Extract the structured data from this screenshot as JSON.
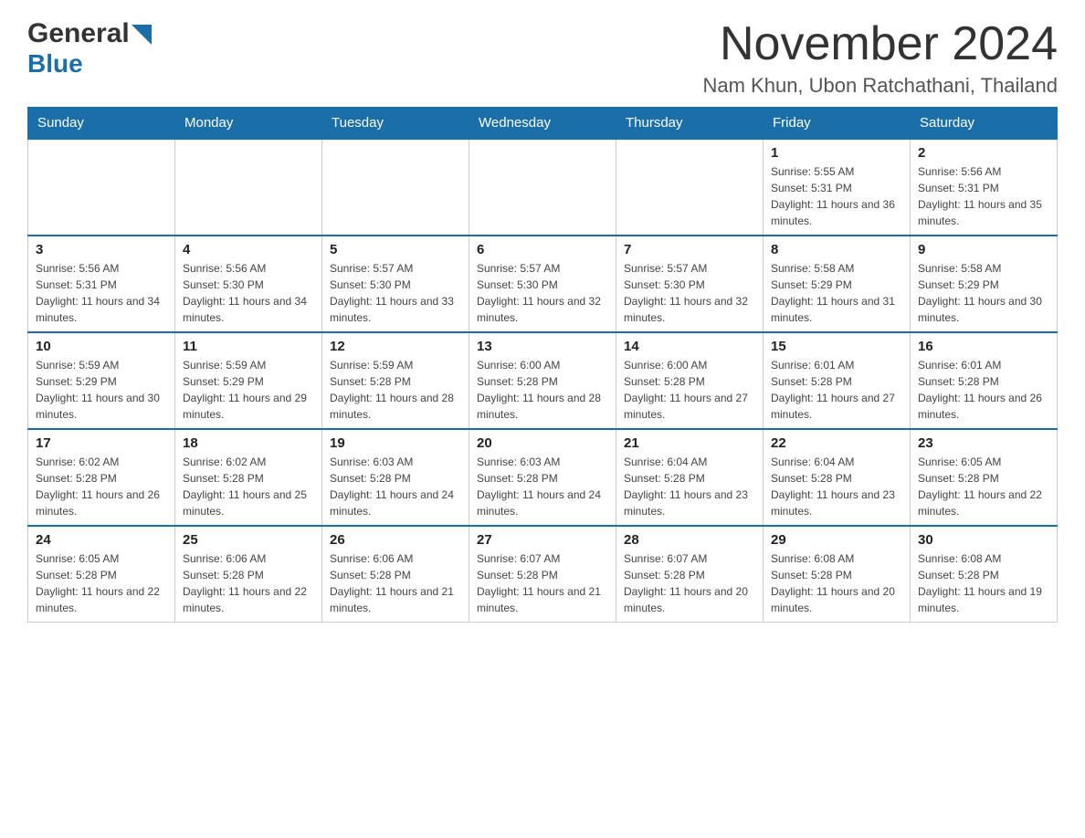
{
  "header": {
    "logo_general": "General",
    "logo_blue": "Blue",
    "title": "November 2024",
    "subtitle": "Nam Khun, Ubon Ratchathani, Thailand"
  },
  "days_of_week": [
    "Sunday",
    "Monday",
    "Tuesday",
    "Wednesday",
    "Thursday",
    "Friday",
    "Saturday"
  ],
  "weeks": [
    [
      {
        "day": "",
        "sunrise": "",
        "sunset": "",
        "daylight": ""
      },
      {
        "day": "",
        "sunrise": "",
        "sunset": "",
        "daylight": ""
      },
      {
        "day": "",
        "sunrise": "",
        "sunset": "",
        "daylight": ""
      },
      {
        "day": "",
        "sunrise": "",
        "sunset": "",
        "daylight": ""
      },
      {
        "day": "",
        "sunrise": "",
        "sunset": "",
        "daylight": ""
      },
      {
        "day": "1",
        "sunrise": "Sunrise: 5:55 AM",
        "sunset": "Sunset: 5:31 PM",
        "daylight": "Daylight: 11 hours and 36 minutes."
      },
      {
        "day": "2",
        "sunrise": "Sunrise: 5:56 AM",
        "sunset": "Sunset: 5:31 PM",
        "daylight": "Daylight: 11 hours and 35 minutes."
      }
    ],
    [
      {
        "day": "3",
        "sunrise": "Sunrise: 5:56 AM",
        "sunset": "Sunset: 5:31 PM",
        "daylight": "Daylight: 11 hours and 34 minutes."
      },
      {
        "day": "4",
        "sunrise": "Sunrise: 5:56 AM",
        "sunset": "Sunset: 5:30 PM",
        "daylight": "Daylight: 11 hours and 34 minutes."
      },
      {
        "day": "5",
        "sunrise": "Sunrise: 5:57 AM",
        "sunset": "Sunset: 5:30 PM",
        "daylight": "Daylight: 11 hours and 33 minutes."
      },
      {
        "day": "6",
        "sunrise": "Sunrise: 5:57 AM",
        "sunset": "Sunset: 5:30 PM",
        "daylight": "Daylight: 11 hours and 32 minutes."
      },
      {
        "day": "7",
        "sunrise": "Sunrise: 5:57 AM",
        "sunset": "Sunset: 5:30 PM",
        "daylight": "Daylight: 11 hours and 32 minutes."
      },
      {
        "day": "8",
        "sunrise": "Sunrise: 5:58 AM",
        "sunset": "Sunset: 5:29 PM",
        "daylight": "Daylight: 11 hours and 31 minutes."
      },
      {
        "day": "9",
        "sunrise": "Sunrise: 5:58 AM",
        "sunset": "Sunset: 5:29 PM",
        "daylight": "Daylight: 11 hours and 30 minutes."
      }
    ],
    [
      {
        "day": "10",
        "sunrise": "Sunrise: 5:59 AM",
        "sunset": "Sunset: 5:29 PM",
        "daylight": "Daylight: 11 hours and 30 minutes."
      },
      {
        "day": "11",
        "sunrise": "Sunrise: 5:59 AM",
        "sunset": "Sunset: 5:29 PM",
        "daylight": "Daylight: 11 hours and 29 minutes."
      },
      {
        "day": "12",
        "sunrise": "Sunrise: 5:59 AM",
        "sunset": "Sunset: 5:28 PM",
        "daylight": "Daylight: 11 hours and 28 minutes."
      },
      {
        "day": "13",
        "sunrise": "Sunrise: 6:00 AM",
        "sunset": "Sunset: 5:28 PM",
        "daylight": "Daylight: 11 hours and 28 minutes."
      },
      {
        "day": "14",
        "sunrise": "Sunrise: 6:00 AM",
        "sunset": "Sunset: 5:28 PM",
        "daylight": "Daylight: 11 hours and 27 minutes."
      },
      {
        "day": "15",
        "sunrise": "Sunrise: 6:01 AM",
        "sunset": "Sunset: 5:28 PM",
        "daylight": "Daylight: 11 hours and 27 minutes."
      },
      {
        "day": "16",
        "sunrise": "Sunrise: 6:01 AM",
        "sunset": "Sunset: 5:28 PM",
        "daylight": "Daylight: 11 hours and 26 minutes."
      }
    ],
    [
      {
        "day": "17",
        "sunrise": "Sunrise: 6:02 AM",
        "sunset": "Sunset: 5:28 PM",
        "daylight": "Daylight: 11 hours and 26 minutes."
      },
      {
        "day": "18",
        "sunrise": "Sunrise: 6:02 AM",
        "sunset": "Sunset: 5:28 PM",
        "daylight": "Daylight: 11 hours and 25 minutes."
      },
      {
        "day": "19",
        "sunrise": "Sunrise: 6:03 AM",
        "sunset": "Sunset: 5:28 PM",
        "daylight": "Daylight: 11 hours and 24 minutes."
      },
      {
        "day": "20",
        "sunrise": "Sunrise: 6:03 AM",
        "sunset": "Sunset: 5:28 PM",
        "daylight": "Daylight: 11 hours and 24 minutes."
      },
      {
        "day": "21",
        "sunrise": "Sunrise: 6:04 AM",
        "sunset": "Sunset: 5:28 PM",
        "daylight": "Daylight: 11 hours and 23 minutes."
      },
      {
        "day": "22",
        "sunrise": "Sunrise: 6:04 AM",
        "sunset": "Sunset: 5:28 PM",
        "daylight": "Daylight: 11 hours and 23 minutes."
      },
      {
        "day": "23",
        "sunrise": "Sunrise: 6:05 AM",
        "sunset": "Sunset: 5:28 PM",
        "daylight": "Daylight: 11 hours and 22 minutes."
      }
    ],
    [
      {
        "day": "24",
        "sunrise": "Sunrise: 6:05 AM",
        "sunset": "Sunset: 5:28 PM",
        "daylight": "Daylight: 11 hours and 22 minutes."
      },
      {
        "day": "25",
        "sunrise": "Sunrise: 6:06 AM",
        "sunset": "Sunset: 5:28 PM",
        "daylight": "Daylight: 11 hours and 22 minutes."
      },
      {
        "day": "26",
        "sunrise": "Sunrise: 6:06 AM",
        "sunset": "Sunset: 5:28 PM",
        "daylight": "Daylight: 11 hours and 21 minutes."
      },
      {
        "day": "27",
        "sunrise": "Sunrise: 6:07 AM",
        "sunset": "Sunset: 5:28 PM",
        "daylight": "Daylight: 11 hours and 21 minutes."
      },
      {
        "day": "28",
        "sunrise": "Sunrise: 6:07 AM",
        "sunset": "Sunset: 5:28 PM",
        "daylight": "Daylight: 11 hours and 20 minutes."
      },
      {
        "day": "29",
        "sunrise": "Sunrise: 6:08 AM",
        "sunset": "Sunset: 5:28 PM",
        "daylight": "Daylight: 11 hours and 20 minutes."
      },
      {
        "day": "30",
        "sunrise": "Sunrise: 6:08 AM",
        "sunset": "Sunset: 5:28 PM",
        "daylight": "Daylight: 11 hours and 19 minutes."
      }
    ]
  ]
}
